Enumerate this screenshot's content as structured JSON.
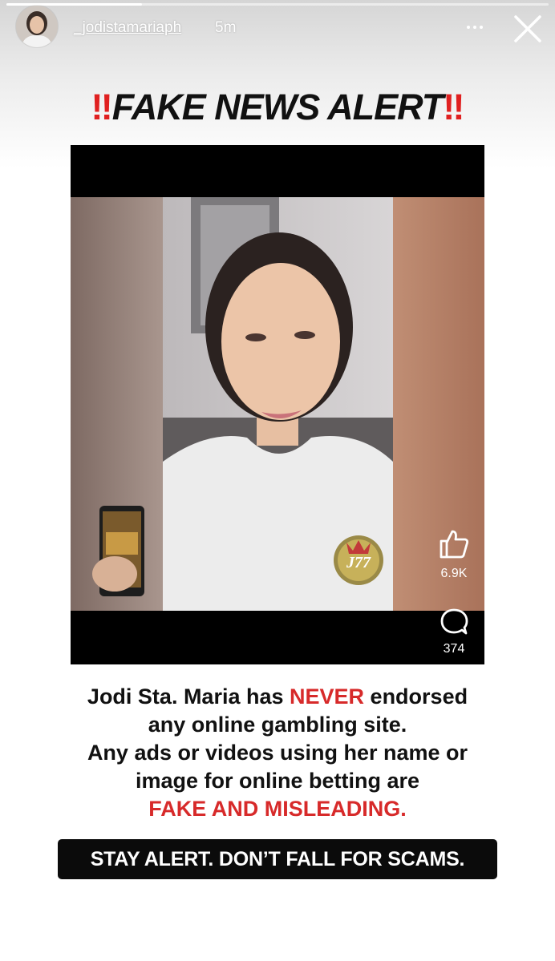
{
  "story": {
    "progress": 0.25,
    "username": "_jodistamariaph",
    "time_ago": "5m",
    "icons": {
      "more": "more-dots-icon",
      "close": "close-icon"
    }
  },
  "post": {
    "title_emoji": "‼",
    "title": "FAKE NEWS ALERT",
    "video": {
      "likes": "6.9K",
      "comments": "374",
      "badge": "J77",
      "icons": {
        "like": "thumbs-up-icon",
        "comment": "comment-bubble-icon"
      }
    },
    "message": {
      "line1_prefix": "Jodi Sta. Maria has ",
      "line1_emphasis": "NEVER",
      "line1_suffix": " endorsed",
      "line2": "any online gambling site.",
      "line3": "Any ads or videos using her name or",
      "line4": "image for online betting are",
      "line5": "FAKE AND MISLEADING."
    },
    "cta": "STAY ALERT. DON’T FALL FOR SCAMS."
  },
  "colors": {
    "alert_red": "#d72a2a",
    "text_dark": "#111111",
    "banner_bg": "#0b0b0b"
  }
}
